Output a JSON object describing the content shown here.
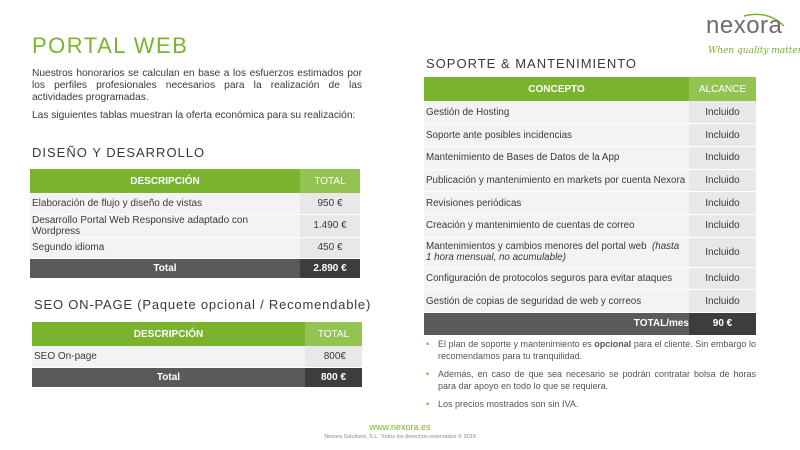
{
  "title": "PORTAL WEB",
  "intro": {
    "p1": "Nuestros honorarios se calculan en base a los esfuerzos estimados por los perfiles profesionales necesarios para la realización de las actividades programadas.",
    "p2": "Las siguientes tablas muestran la oferta económica para su realización:"
  },
  "design": {
    "title": "DISEÑO Y DESARROLLO",
    "headers": [
      "DESCRIPCIÓN",
      "TOTAL"
    ],
    "rows": [
      {
        "desc": "Elaboración de flujo y diseño de vistas",
        "value": "950 €"
      },
      {
        "desc": "Desarrollo Portal Web Responsive adaptado con Wordpress",
        "value": "1.490 €"
      },
      {
        "desc": "Segundo idioma",
        "value": "450 €"
      }
    ],
    "total_label": "Total",
    "total_value": "2.890 €"
  },
  "seo": {
    "title": "SEO ON-PAGE (Paquete opcional / Recomendable)",
    "headers": [
      "DESCRIPCIÓN",
      "TOTAL"
    ],
    "rows": [
      {
        "desc": "SEO On-page",
        "value": "800€"
      }
    ],
    "total_label": "Total",
    "total_value": "800 €"
  },
  "support": {
    "title": "SOPORTE & MANTENIMIENTO",
    "headers": [
      "CONCEPTO",
      "ALCANCE"
    ],
    "rows": [
      {
        "concept": "Gestión de Hosting",
        "scope": "Incluido"
      },
      {
        "concept": "Soporte ante posibles incidencias",
        "scope": "Incluido"
      },
      {
        "concept": "Mantenimiento de Bases de Datos de la App",
        "scope": "Incluido"
      },
      {
        "concept": "Publicación y mantenimiento en markets por cuenta Nexora",
        "scope": "Incluido"
      },
      {
        "concept": "Revisiones periódicas",
        "scope": "Incluido"
      },
      {
        "concept": "Creación y mantenimiento de cuentas de correo",
        "scope": "Incluido"
      },
      {
        "concept": "Mantenimientos y cambios menores del portal web",
        "concept_note": "(hasta 1 hora mensual, no acumulable)",
        "scope": "Incluido"
      },
      {
        "concept": "Configuración de protocolos seguros para evitar ataques",
        "scope": "Incluido"
      },
      {
        "concept": "Gestión de copias de seguridad de web y correos",
        "scope": "Incluido"
      }
    ],
    "total_label": "TOTAL/mes",
    "total_value": "90 €"
  },
  "notes": {
    "n1_pre": "El plan de soporte y mantenimiento es ",
    "n1_bold": "opcional",
    "n1_post": " para el cliente. Sin embargo lo recomendamos para tu tranquilidad.",
    "n2": "Además, en caso de que sea necesario se podrán contratar bolsa de horas para dar apoyo en todo lo que se requiera.",
    "n3": "Los precios mostrados son sin IVA."
  },
  "logo": {
    "name": "nexora",
    "tagline": "When quality matters"
  },
  "footer": {
    "url": "www.nexora.es",
    "copyright": "Nexora Solutions, S.L. Todos los derechos reservados © 2019"
  },
  "colors": {
    "accent": "#7ab32e",
    "total_bg": "#5a5a5a",
    "total_value_bg": "#3d3d3d"
  }
}
